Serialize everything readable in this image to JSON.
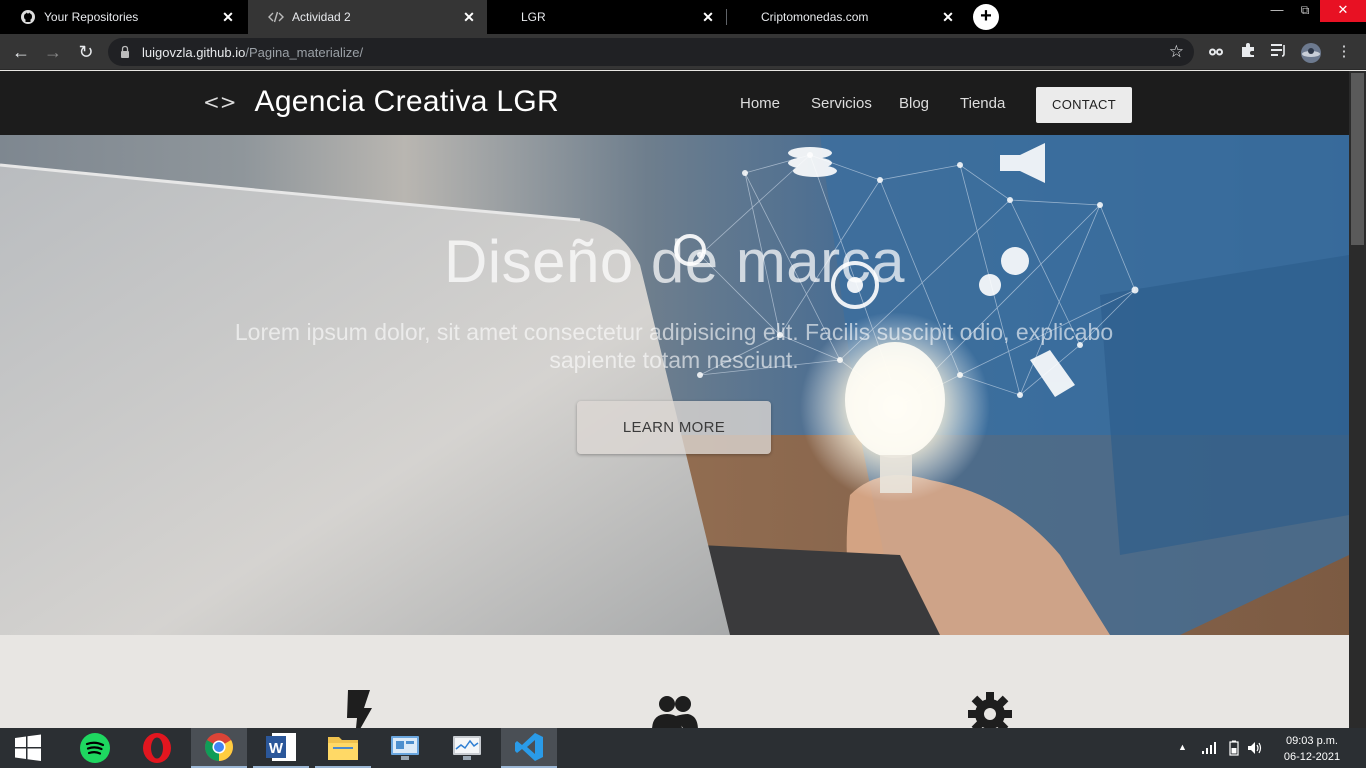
{
  "browser": {
    "tabs": [
      {
        "title": "Your Repositories",
        "icon": "github-icon",
        "active": false
      },
      {
        "title": "Actividad 2",
        "icon": "code-icon",
        "active": true
      },
      {
        "title": "LGR",
        "icon": "",
        "active": false
      },
      {
        "title": "Criptomonedas.com",
        "icon": "",
        "active": false
      }
    ],
    "close_glyph": "✕",
    "new_tab_glyph": "+",
    "url_host": "luigovzla.github.io",
    "url_path": "/Pagina_materialize/"
  },
  "site": {
    "brand_icon": "<>",
    "brand_name": "Agencia Creativa LGR",
    "nav": {
      "home": "Home",
      "servicios": "Servicios",
      "blog": "Blog",
      "tienda": "Tienda",
      "contact": "CONTACT"
    },
    "hero": {
      "title": "Diseño de marca",
      "subtitle": "Lorem ipsum dolor, sit amet consectetur adipisicing elit. Facilis suscipit odio, explicabo sapiente totam nesciunt.",
      "button": "LEARN MORE"
    },
    "features": [
      {
        "icon": "flash-icon"
      },
      {
        "icon": "group-icon"
      },
      {
        "icon": "settings-icon"
      }
    ]
  },
  "taskbar": {
    "apps": [
      "start-icon",
      "spotify-icon",
      "opera-icon",
      "chrome-icon",
      "word-icon",
      "file-explorer-icon",
      "control-panel-icon",
      "performance-monitor-icon",
      "vscode-icon"
    ],
    "clock_time": "09:03 p.m.",
    "clock_date": "06-12-2021"
  }
}
